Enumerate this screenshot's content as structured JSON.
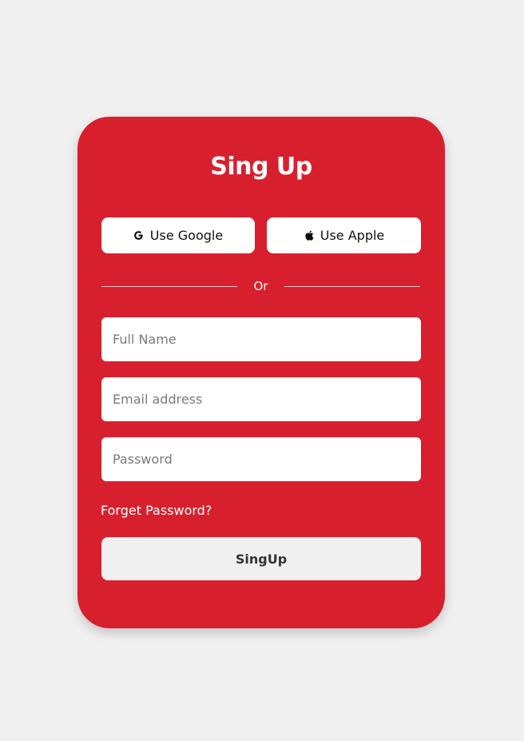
{
  "form": {
    "title": "Sing Up",
    "social": {
      "google_label": "Use Google",
      "apple_label": "Use Apple"
    },
    "divider_text": "Or",
    "fields": {
      "full_name": {
        "placeholder": "Full Name",
        "value": ""
      },
      "email": {
        "placeholder": "Email address",
        "value": ""
      },
      "password": {
        "placeholder": "Password",
        "value": ""
      }
    },
    "forgot_password": "Forget Password?",
    "submit_label": "SingUp"
  },
  "icons": {
    "google": "google-icon",
    "apple": "apple-icon"
  },
  "colors": {
    "page_background": "#f0f0f0",
    "card_background": "#d81f2e",
    "text_on_card": "#ffffff",
    "button_background": "#ffffff",
    "submit_background": "#f0f0f0"
  }
}
